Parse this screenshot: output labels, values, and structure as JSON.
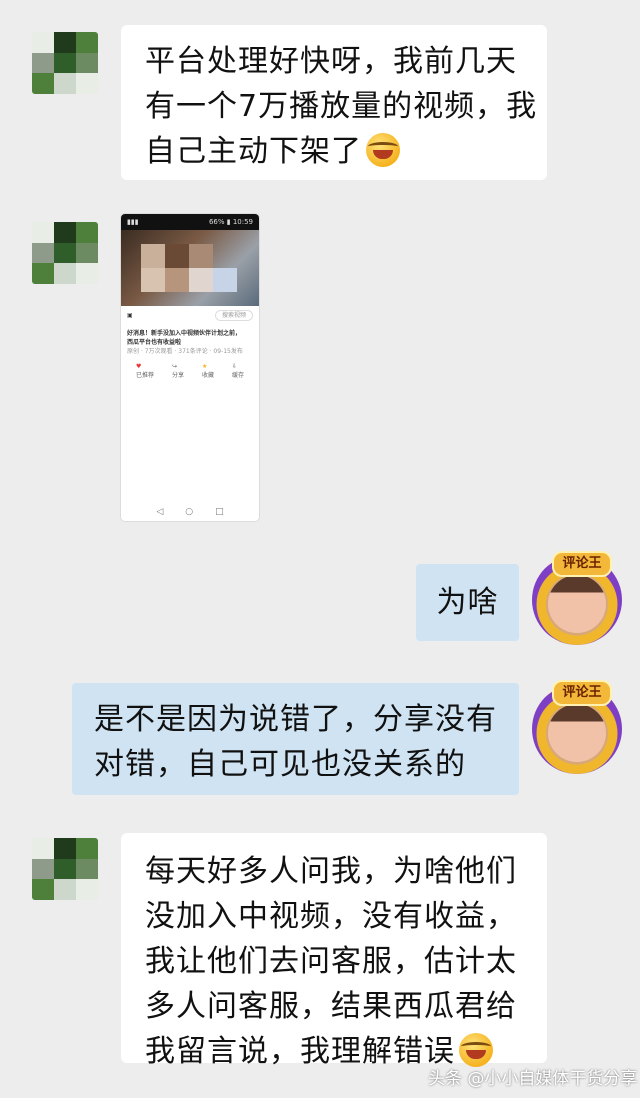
{
  "messages": {
    "m1": {
      "lines": [
        "平台处理好快呀，我前几天",
        "有一个7万播放量的视频，我",
        "自己主动下架了"
      ],
      "emoji": "laughing-crying-emoji"
    },
    "m2": {
      "type": "image",
      "phone": {
        "status_right": "66% ▮ 10:59",
        "search_chip": "搜索视频",
        "title_lines": [
          "好消息！新手没加入中视频伙伴计划之前，",
          "西瓜平台也有收益啦"
        ],
        "meta": "原创 · 7万次观看 · 371条评论 · 09-15发布",
        "actions": [
          "已推荐",
          "分享",
          "收藏",
          "缓存"
        ]
      }
    },
    "m3": {
      "text": "为啥"
    },
    "m4": {
      "lines": [
        "是不是因为说错了，分享没有",
        "对错，自己可见也没关系的"
      ]
    },
    "m5": {
      "lines": [
        "每天好多人问我，为啥他们",
        "没加入中视频，没有收益，",
        "我让他们去问客服，估计太",
        "多人问客服，结果西瓜君给",
        "我留言说，我理解错误"
      ],
      "emoji": "laughing-crying-emoji"
    }
  },
  "badge_label": "评论王",
  "watermark": "头条 @小小自媒体干货分享",
  "colors": {
    "background": "#ededed",
    "incoming_bubble": "#ffffff",
    "outgoing_bubble": "#cfe3f2"
  }
}
